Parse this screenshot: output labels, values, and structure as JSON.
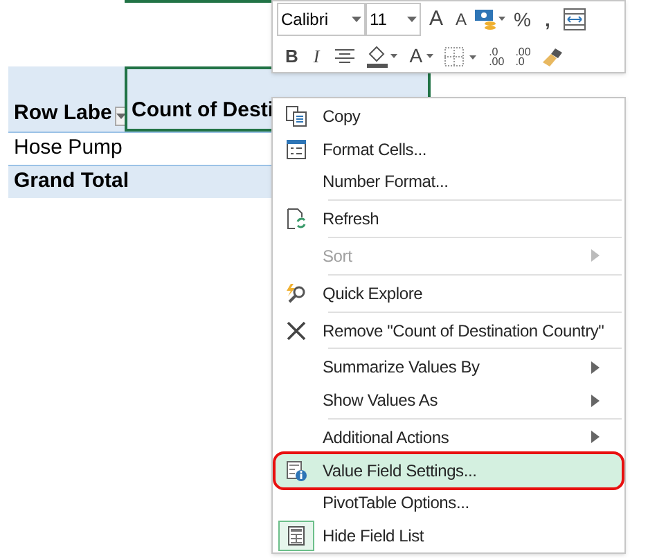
{
  "mini_toolbar": {
    "font": "Calibri",
    "size": "11",
    "buttons_row_1": [
      "A",
      "A",
      "%",
      ","
    ],
    "buttons_row_2": [
      "B",
      "I",
      "A"
    ],
    "decimals": [
      ".0",
      ".00",
      ".00",
      ".0"
    ]
  },
  "pivot": {
    "header": [
      {
        "text": "Row Labe"
      },
      {
        "text": "Count of Desti"
      }
    ],
    "rows": [
      {
        "text": "Hose Pump",
        "bold": false
      },
      {
        "text": "Grand Total",
        "bold": true
      }
    ]
  },
  "menu": [
    {
      "kind": "item",
      "label": "Copy",
      "disabled": false,
      "submenu": false,
      "selected": false,
      "checked": false
    },
    {
      "kind": "item",
      "label": "Format Cells...",
      "disabled": false,
      "submenu": false,
      "selected": false,
      "checked": false
    },
    {
      "kind": "item",
      "label": "Number Format...",
      "disabled": false,
      "submenu": false,
      "selected": false,
      "checked": false
    },
    {
      "kind": "separator"
    },
    {
      "kind": "item",
      "label": "Refresh",
      "disabled": false,
      "submenu": false,
      "selected": false,
      "checked": false
    },
    {
      "kind": "separator"
    },
    {
      "kind": "item",
      "label": "Sort",
      "disabled": true,
      "submenu": true,
      "selected": false,
      "checked": false
    },
    {
      "kind": "separator"
    },
    {
      "kind": "item",
      "label": "Quick Explore",
      "disabled": false,
      "submenu": false,
      "selected": false,
      "checked": false
    },
    {
      "kind": "separator"
    },
    {
      "kind": "item",
      "label": "Remove \"Count of Destination Country\"",
      "disabled": false,
      "submenu": false,
      "selected": false,
      "checked": false
    },
    {
      "kind": "separator"
    },
    {
      "kind": "item",
      "label": "Summarize Values By",
      "disabled": false,
      "submenu": true,
      "selected": false,
      "checked": false
    },
    {
      "kind": "item",
      "label": "Show Values As",
      "disabled": false,
      "submenu": true,
      "selected": false,
      "checked": false
    },
    {
      "kind": "separator"
    },
    {
      "kind": "item",
      "label": "Additional Actions",
      "disabled": false,
      "submenu": true,
      "selected": false,
      "checked": false
    },
    {
      "kind": "item",
      "label": "Value Field Settings...",
      "disabled": false,
      "submenu": false,
      "selected": true,
      "checked": false
    },
    {
      "kind": "item",
      "label": "PivotTable Options...",
      "disabled": false,
      "submenu": false,
      "selected": false,
      "checked": false
    },
    {
      "kind": "item",
      "label": "Hide Field List",
      "disabled": false,
      "submenu": false,
      "selected": false,
      "checked": true
    }
  ]
}
